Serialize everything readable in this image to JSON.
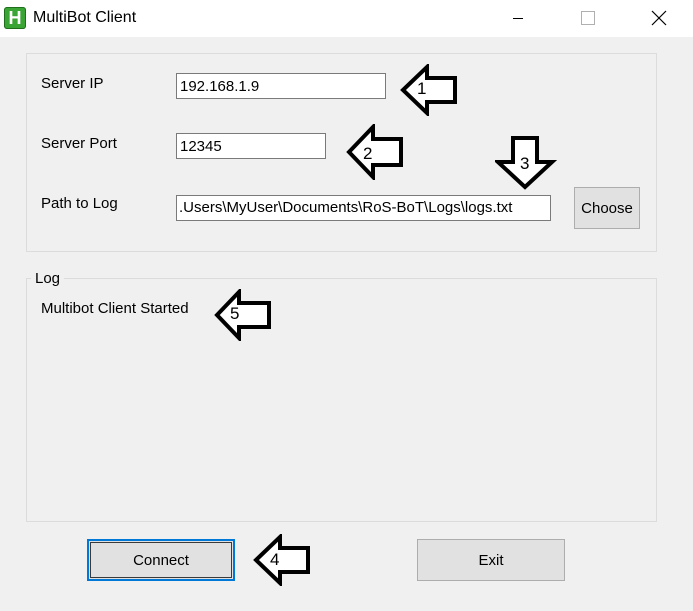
{
  "window": {
    "icon_letter": "H",
    "title": "MultiBot Client"
  },
  "settings": {
    "server_ip_label": "Server IP",
    "server_ip_value": "192.168.1.9",
    "server_port_label": "Server Port",
    "server_port_value": "12345",
    "path_label": "Path to Log",
    "path_value": ".Users\\MyUser\\Documents\\RoS-BoT\\Logs\\logs.txt",
    "choose_label": "Choose"
  },
  "log": {
    "group_label": "Log",
    "lines": [
      "Multibot Client Started"
    ]
  },
  "actions": {
    "connect_label": "Connect",
    "exit_label": "Exit"
  },
  "annotations": {
    "arrow_1": "1",
    "arrow_2": "2",
    "arrow_3": "3",
    "arrow_4": "4",
    "arrow_5": "5"
  }
}
